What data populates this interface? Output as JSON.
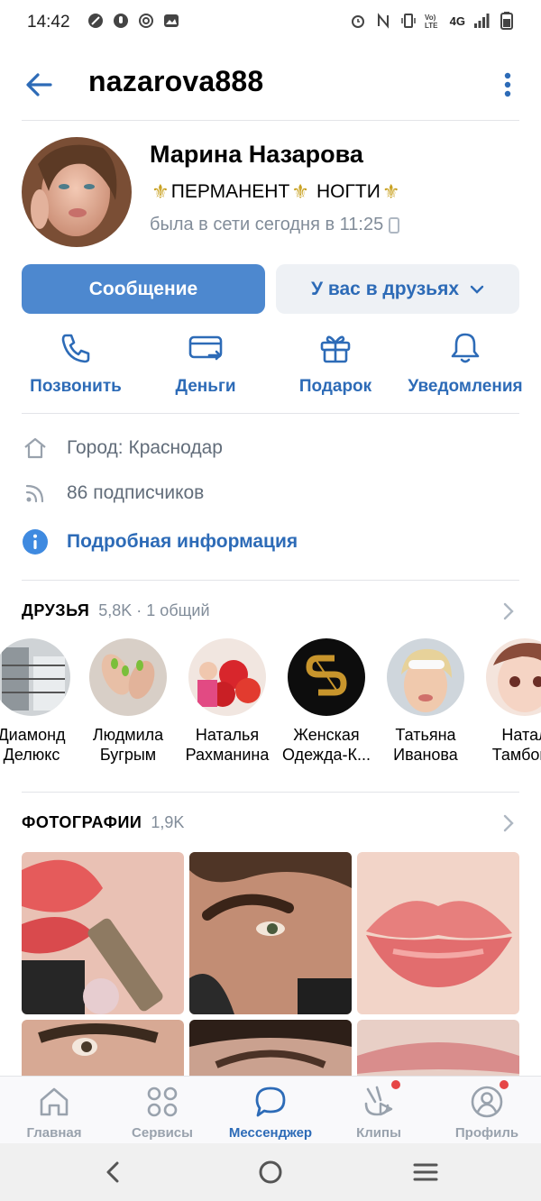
{
  "status": {
    "time": "14:42",
    "network": "4G"
  },
  "header": {
    "username": "nazarova888"
  },
  "profile": {
    "name": "Марина Назарова",
    "status_part1": "ПЕРМАНЕНТ",
    "status_part2": "НОГТИ",
    "online": "была в сети сегодня в 11:25"
  },
  "buttons": {
    "message": "Сообщение",
    "friends": "У вас в друзьях"
  },
  "actions": [
    {
      "label": "Позвонить",
      "icon": "phone-icon"
    },
    {
      "label": "Деньги",
      "icon": "money-icon"
    },
    {
      "label": "Подарок",
      "icon": "gift-icon"
    },
    {
      "label": "Уведомления",
      "icon": "bell-icon"
    }
  ],
  "info": {
    "city": "Город: Краснодар",
    "subscribers": "86 подписчиков",
    "details": "Подробная информация"
  },
  "friends_section": {
    "title": "ДРУЗЬЯ",
    "count": "5,8K · 1 общий",
    "items": [
      {
        "line1": "Диамонд",
        "line2": "Делюкс"
      },
      {
        "line1": "Людмила",
        "line2": "Бугрым"
      },
      {
        "line1": "Наталья",
        "line2": "Рахманина"
      },
      {
        "line1": "Женская",
        "line2": "Одежда-К..."
      },
      {
        "line1": "Татьяна",
        "line2": "Иванова"
      },
      {
        "line1": "Натал",
        "line2": "Тамбовц"
      }
    ]
  },
  "photos_section": {
    "title": "ФОТОГРАФИИ",
    "count": "1,9K"
  },
  "tabbar": [
    {
      "label": "Главная",
      "icon": "home-icon"
    },
    {
      "label": "Сервисы",
      "icon": "services-icon"
    },
    {
      "label": "Мессенджер",
      "icon": "messenger-icon"
    },
    {
      "label": "Клипы",
      "icon": "clips-icon"
    },
    {
      "label": "Профиль",
      "icon": "profile-icon"
    }
  ],
  "colors": {
    "accent": "#2d6bb7",
    "primary_button": "#4d88cf",
    "secondary_text": "#818c99",
    "badge": "#e64646"
  }
}
